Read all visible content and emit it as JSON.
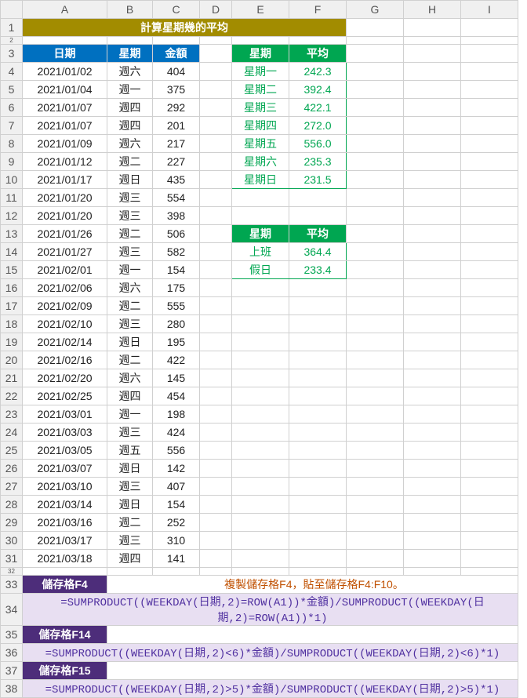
{
  "col_heads": [
    "A",
    "B",
    "C",
    "D",
    "E",
    "F",
    "G",
    "H",
    "I"
  ],
  "title": "計算星期幾的平均",
  "table_headers": {
    "date": "日期",
    "weekday": "星期",
    "amount": "金額"
  },
  "avg_headers": {
    "weekday": "星期",
    "avg": "平均"
  },
  "data_rows": [
    {
      "r": 4,
      "d": "2021/01/02",
      "w": "週六",
      "a": "404"
    },
    {
      "r": 5,
      "d": "2021/01/04",
      "w": "週一",
      "a": "375"
    },
    {
      "r": 6,
      "d": "2021/01/07",
      "w": "週四",
      "a": "292"
    },
    {
      "r": 7,
      "d": "2021/01/07",
      "w": "週四",
      "a": "201"
    },
    {
      "r": 8,
      "d": "2021/01/09",
      "w": "週六",
      "a": "217"
    },
    {
      "r": 9,
      "d": "2021/01/12",
      "w": "週二",
      "a": "227"
    },
    {
      "r": 10,
      "d": "2021/01/17",
      "w": "週日",
      "a": "435"
    },
    {
      "r": 11,
      "d": "2021/01/20",
      "w": "週三",
      "a": "554"
    },
    {
      "r": 12,
      "d": "2021/01/20",
      "w": "週三",
      "a": "398"
    },
    {
      "r": 13,
      "d": "2021/01/26",
      "w": "週二",
      "a": "506"
    },
    {
      "r": 14,
      "d": "2021/01/27",
      "w": "週三",
      "a": "582"
    },
    {
      "r": 15,
      "d": "2021/02/01",
      "w": "週一",
      "a": "154"
    },
    {
      "r": 16,
      "d": "2021/02/06",
      "w": "週六",
      "a": "175"
    },
    {
      "r": 17,
      "d": "2021/02/09",
      "w": "週二",
      "a": "555"
    },
    {
      "r": 18,
      "d": "2021/02/10",
      "w": "週三",
      "a": "280"
    },
    {
      "r": 19,
      "d": "2021/02/14",
      "w": "週日",
      "a": "195"
    },
    {
      "r": 20,
      "d": "2021/02/16",
      "w": "週二",
      "a": "422"
    },
    {
      "r": 21,
      "d": "2021/02/20",
      "w": "週六",
      "a": "145"
    },
    {
      "r": 22,
      "d": "2021/02/25",
      "w": "週四",
      "a": "454"
    },
    {
      "r": 23,
      "d": "2021/03/01",
      "w": "週一",
      "a": "198"
    },
    {
      "r": 24,
      "d": "2021/03/03",
      "w": "週三",
      "a": "424"
    },
    {
      "r": 25,
      "d": "2021/03/05",
      "w": "週五",
      "a": "556"
    },
    {
      "r": 26,
      "d": "2021/03/07",
      "w": "週日",
      "a": "142"
    },
    {
      "r": 27,
      "d": "2021/03/10",
      "w": "週三",
      "a": "407"
    },
    {
      "r": 28,
      "d": "2021/03/14",
      "w": "週日",
      "a": "154"
    },
    {
      "r": 29,
      "d": "2021/03/16",
      "w": "週二",
      "a": "252"
    },
    {
      "r": 30,
      "d": "2021/03/17",
      "w": "週三",
      "a": "310"
    },
    {
      "r": 31,
      "d": "2021/03/18",
      "w": "週四",
      "a": "141"
    }
  ],
  "weekday_avg": [
    {
      "r": 4,
      "w": "星期一",
      "v": "242.3"
    },
    {
      "r": 5,
      "w": "星期二",
      "v": "392.4"
    },
    {
      "r": 6,
      "w": "星期三",
      "v": "422.1"
    },
    {
      "r": 7,
      "w": "星期四",
      "v": "272.0"
    },
    {
      "r": 8,
      "w": "星期五",
      "v": "556.0"
    },
    {
      "r": 9,
      "w": "星期六",
      "v": "235.3"
    },
    {
      "r": 10,
      "w": "星期日",
      "v": "231.5"
    }
  ],
  "category_avg": [
    {
      "r": 14,
      "w": "上班",
      "v": "364.4"
    },
    {
      "r": 15,
      "w": "假日",
      "v": "233.4"
    }
  ],
  "formula_labels": {
    "f4": "儲存格F4",
    "f4_note": "複製儲存格F4，貼至儲存格F4:F10。",
    "f14": "儲存格F14",
    "f15": "儲存格F15"
  },
  "formulas": {
    "f4": "=SUMPRODUCT((WEEKDAY(日期,2)=ROW(A1))*金額)/SUMPRODUCT((WEEKDAY(日期,2)=ROW(A1))*1)",
    "f14": "=SUMPRODUCT((WEEKDAY(日期,2)<6)*金額)/SUMPRODUCT((WEEKDAY(日期,2)<6)*1)",
    "f15": "=SUMPRODUCT((WEEKDAY(日期,2)>5)*金額)/SUMPRODUCT((WEEKDAY(日期,2)>5)*1)"
  }
}
